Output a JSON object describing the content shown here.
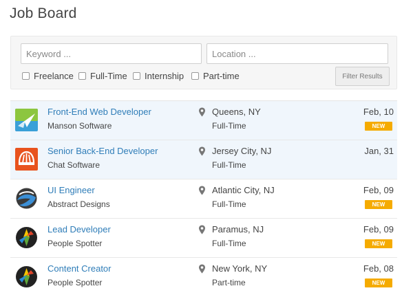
{
  "page": {
    "title": "Job Board"
  },
  "filters": {
    "keyword_placeholder": "Keyword ...",
    "location_placeholder": "Location ...",
    "checkboxes": [
      "Freelance",
      "Full-Time",
      "Internship",
      "Part-time"
    ],
    "button_label": "Filter Results"
  },
  "colors": {
    "link": "#2f7db8",
    "badge": "#f5ab00",
    "featured_row": "#f0f6fc"
  },
  "jobs": [
    {
      "title": "Front-End Web Developer",
      "company": "Manson Software",
      "location": "Queens, NY",
      "type": "Full-Time",
      "date": "Feb, 10",
      "badge": "NEW",
      "logo": "paper-plane-logo-icon"
    },
    {
      "title": "Senior Back-End Developer",
      "company": "Chat Software",
      "location": "Jersey City, NJ",
      "type": "Full-Time",
      "date": "Jan, 31",
      "badge": "",
      "logo": "chat-shell-logo-icon"
    },
    {
      "title": "UI Engineer",
      "company": "Abstract Designs",
      "location": "Atlantic City, NJ",
      "type": "Full-Time",
      "date": "Feb, 09",
      "badge": "NEW",
      "logo": "abstract-swirl-logo-icon"
    },
    {
      "title": "Lead Developer",
      "company": "People Spotter",
      "location": "Paramus, NJ",
      "type": "Full-Time",
      "date": "Feb, 09",
      "badge": "NEW",
      "logo": "spotter-logo-icon"
    },
    {
      "title": "Content Creator",
      "company": "People Spotter",
      "location": "New York, NY",
      "type": "Part-time",
      "date": "Feb, 08",
      "badge": "NEW",
      "logo": "spotter-logo-icon"
    }
  ]
}
